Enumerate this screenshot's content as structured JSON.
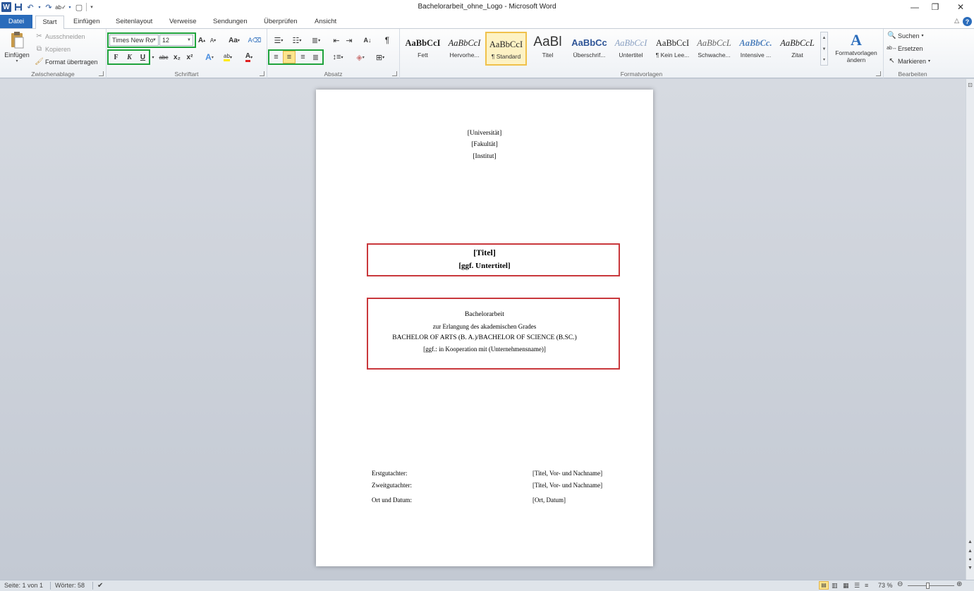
{
  "window": {
    "title": "Bachelorarbeit_ohne_Logo - Microsoft Word",
    "minimize": "—",
    "restore": "❐",
    "close": "✕"
  },
  "tabs": [
    "Datei",
    "Start",
    "Einfügen",
    "Seitenlayout",
    "Verweise",
    "Sendungen",
    "Überprüfen",
    "Ansicht"
  ],
  "ribbon": {
    "clipboard": {
      "paste_label": "Einfügen",
      "cut_label": "Ausschneiden",
      "copy_label": "Kopieren",
      "format_painter_label": "Format übertragen",
      "group_label": "Zwischenablage"
    },
    "font": {
      "font_name": "Times New Ro",
      "font_size": "12",
      "bold": "F",
      "italic": "K",
      "underline": "U",
      "strike": "abc",
      "subscript": "x₂",
      "superscript": "x²",
      "change_case": "Aa",
      "group_label": "Schriftart"
    },
    "paragraph": {
      "group_label": "Absatz"
    },
    "styles": {
      "items": [
        {
          "sample": "AaBbCcI",
          "name": "Fett"
        },
        {
          "sample": "AaBbCcI",
          "name": "Hervorhe..."
        },
        {
          "sample": "AaBbCcI",
          "name": "¶ Standard"
        },
        {
          "sample": "AaBl",
          "name": "Titel"
        },
        {
          "sample": "AaBbCc",
          "name": "Überschrif..."
        },
        {
          "sample": "AaBbCcI",
          "name": "Untertitel"
        },
        {
          "sample": "AaBbCcI",
          "name": "¶ Kein Lee..."
        },
        {
          "sample": "AaBbCcL",
          "name": "Schwache..."
        },
        {
          "sample": "AaBbCc.",
          "name": "Intensive ..."
        },
        {
          "sample": "AaBbCcL",
          "name": "Zitat"
        }
      ],
      "change_styles_label": "Formatvorlagen ändern",
      "group_label": "Formatvorlagen"
    },
    "editing": {
      "find_label": "Suchen",
      "replace_label": "Ersetzen",
      "select_label": "Markieren",
      "group_label": "Bearbeiten"
    }
  },
  "document": {
    "university": "[Universität]",
    "faculty": "[Fakultät]",
    "institute": "[Institut]",
    "title": "[Titel]",
    "subtitle": "[ggf. Untertitel]",
    "thesis_type": "Bachelorarbeit",
    "degree_intro": "zur Erlangung des akademischen Grades",
    "degree": "BACHELOR OF ARTS (B. A.)/BACHELOR OF SCIENCE (B.SC.)",
    "cooperation": "[ggf.: in Kooperation mit (Unternehmensname)]",
    "first_reviewer_label": "Erstgutachter:",
    "first_reviewer_value": "[Titel, Vor- und Nachname]",
    "second_reviewer_label": "Zweitgutachter:",
    "second_reviewer_value": "[Titel, Vor- und Nachname]",
    "place_date_label": "Ort und Datum:",
    "place_date_value": "[Ort, Datum]"
  },
  "status": {
    "page": "Seite: 1 von 1",
    "words": "Wörter: 58",
    "zoom": "73 %"
  },
  "colors": {
    "file_tab": "#2a6cbb",
    "highlight_outline": "#1fa33c",
    "redbox": "#c9383c",
    "selected_style": "#f0c14b"
  }
}
